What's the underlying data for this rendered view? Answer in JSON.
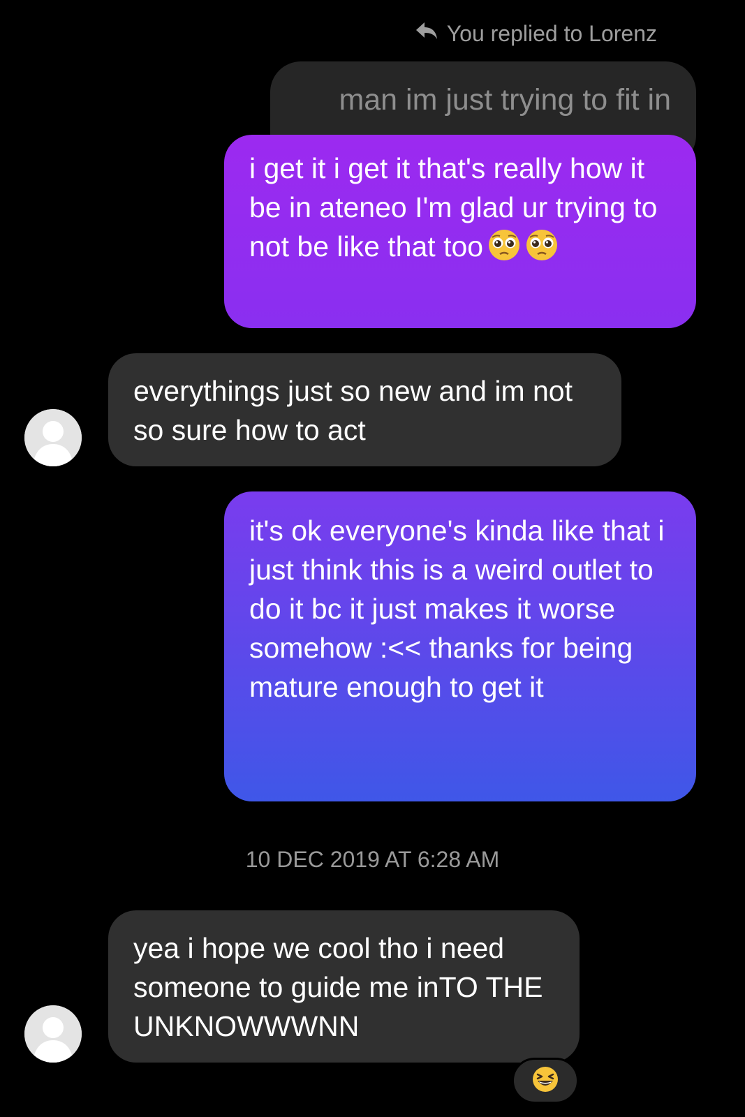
{
  "reply_header": {
    "icon": "reply-arrow-icon",
    "text": "You replied to Lorenz"
  },
  "quoted_message": {
    "text": "man im just trying to fit in"
  },
  "messages": [
    {
      "direction": "outgoing",
      "text": "i get it i get it that's really how it be in ateneo I'm glad ur trying to not be like that too",
      "emoji": [
        "pleading-face-icon",
        "pleading-face-icon"
      ]
    },
    {
      "direction": "incoming",
      "avatar": "default-avatar-icon",
      "text": "everythings just so new and im not so sure how to act"
    },
    {
      "direction": "outgoing",
      "text": "it's ok everyone's kinda like that i just think this is a weird outlet to do it bc it just makes it worse somehow :<< thanks for being mature enough to get it"
    },
    {
      "direction": "incoming",
      "avatar": "default-avatar-icon",
      "text": "yea i hope we cool tho i need someone to guide me inTO THE UNKNOWWWNN",
      "reaction": "grinning-squinting-face-icon"
    }
  ],
  "timestamp": "10 DEC 2019 AT 6:28 AM",
  "colors": {
    "background": "#000000",
    "incoming_bubble": "#303030",
    "quoted_bubble": "#262626",
    "outgoing_gradient_top": "#9c2af0",
    "outgoing_gradient_bottom": "#3f57e8",
    "meta_text": "#9e9e9e"
  }
}
